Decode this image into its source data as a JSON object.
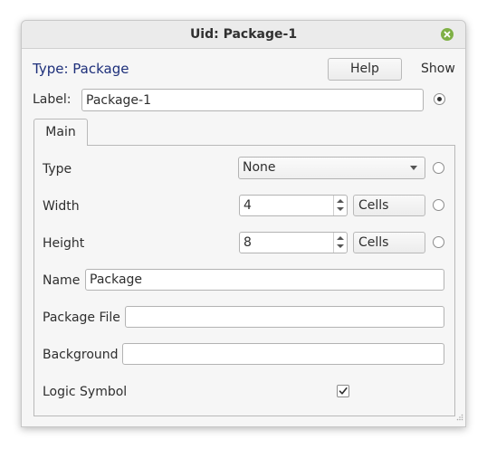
{
  "window": {
    "title": "Uid: Package-1",
    "close_icon": "close-icon",
    "close_color": "#7fb045"
  },
  "header": {
    "type_label": "Type: Package",
    "type_color": "#1d2f7a",
    "help_label": "Help",
    "show_label": "Show"
  },
  "label_row": {
    "label": "Label:",
    "value": "Package-1",
    "show_selected": true
  },
  "tabs": [
    {
      "label": "Main",
      "active": true
    }
  ],
  "main": {
    "type": {
      "label": "Type",
      "selected": "None"
    },
    "width": {
      "label": "Width",
      "value": "4",
      "unit": "Cells"
    },
    "height": {
      "label": "Height",
      "value": "8",
      "unit": "Cells"
    },
    "name": {
      "label": "Name",
      "value": "Package"
    },
    "package_file": {
      "label": "Package File",
      "value": ""
    },
    "background": {
      "label": "Background",
      "value": ""
    },
    "logic_symbol": {
      "label": "Logic Symbol",
      "checked": true
    }
  }
}
